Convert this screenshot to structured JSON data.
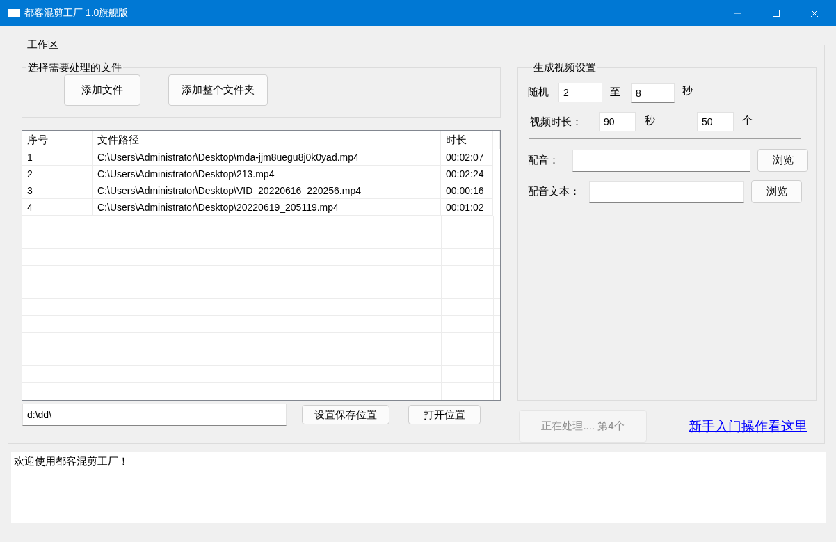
{
  "window": {
    "title": "都客混剪工厂 1.0旗舰版"
  },
  "workspace": {
    "title": "工作区"
  },
  "file_group": {
    "title": "选择需要处理的文件",
    "buttons": [
      "添加文件",
      "添加整个文件夹"
    ]
  },
  "table": {
    "columns": [
      "序号",
      "文件路径",
      "时长"
    ],
    "rows": [
      {
        "index": "1",
        "path": "C:\\Users\\Administrator\\Desktop\\mda-jjm8uegu8j0k0yad.mp4",
        "duration": "00:02:07"
      },
      {
        "index": "2",
        "path": "C:\\Users\\Administrator\\Desktop\\213.mp4",
        "duration": "00:02:24"
      },
      {
        "index": "3",
        "path": "C:\\Users\\Administrator\\Desktop\\VID_20220616_220256.mp4",
        "duration": "00:00:16"
      },
      {
        "index": "4",
        "path": "C:\\Users\\Administrator\\Desktop\\20220619_205119.mp4",
        "duration": "00:01:02"
      }
    ]
  },
  "settings": {
    "title": "生成视频设置",
    "random": {
      "label": "随机",
      "from": "2",
      "to_label": "至",
      "to": "8",
      "unit": "秒"
    },
    "duration": {
      "label": "视频时长：",
      "value": "90",
      "unit": "秒",
      "count": "50",
      "count_unit": "个"
    },
    "audio": {
      "label": "配音：",
      "button": "浏览"
    },
    "audio_text": {
      "label": "配音文本：",
      "button": "浏览"
    }
  },
  "save": {
    "path": "d:\\dd\\",
    "set_button": "设置保存位置",
    "open_button": "打开位置"
  },
  "process_button": {
    "label": "正在处理.... 第4个",
    "disabled": true
  },
  "help_link": "新手入门操作看这里",
  "log": "欢迎使用都客混剪工厂！"
}
